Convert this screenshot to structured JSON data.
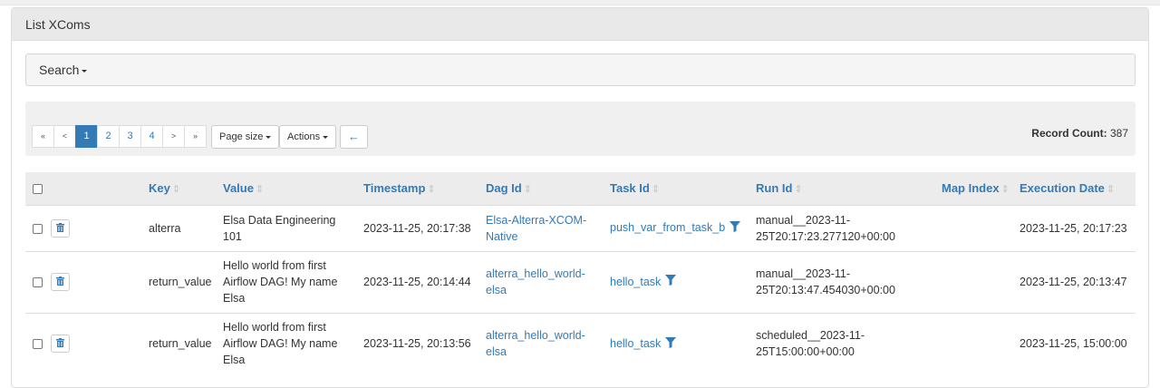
{
  "panel": {
    "title": "List XComs"
  },
  "search": {
    "label": "Search"
  },
  "pager": {
    "first": "«",
    "prev": "<",
    "pages": [
      "1",
      "2",
      "3",
      "4"
    ],
    "active_page": "1",
    "next": ">",
    "last": "»"
  },
  "toolbar": {
    "page_size_label": "Page size",
    "actions_label": "Actions",
    "back_icon": "←",
    "record_count_label": "Record Count:",
    "record_count_value": "387"
  },
  "table": {
    "columns": [
      "Key",
      "Value",
      "Timestamp",
      "Dag Id",
      "Task Id",
      "Run Id",
      "Map Index",
      "Execution Date"
    ],
    "rows": [
      {
        "key": "alterra",
        "value": [
          "Elsa Data Engineering",
          "101"
        ],
        "timestamp": "2023-11-25, 20:17:38",
        "dag_id": [
          "Elsa-Alterra-XCOM-",
          "Native"
        ],
        "task_id": "push_var_from_task_b",
        "run_id": [
          "manual__2023-11-",
          "25T20:17:23.277120+00:00"
        ],
        "map_index": "",
        "execution_date": "2023-11-25, 20:17:23"
      },
      {
        "key": "return_value",
        "value": [
          "Hello world from first",
          "Airflow DAG! My name",
          "Elsa"
        ],
        "timestamp": "2023-11-25, 20:14:44",
        "dag_id": [
          "alterra_hello_world-",
          "elsa"
        ],
        "task_id": "hello_task",
        "run_id": [
          "manual__2023-11-",
          "25T20:13:47.454030+00:00"
        ],
        "map_index": "",
        "execution_date": "2023-11-25, 20:13:47"
      },
      {
        "key": "return_value",
        "value": [
          "Hello world from first",
          "Airflow DAG! My name",
          "Elsa"
        ],
        "timestamp": "2023-11-25, 20:13:56",
        "dag_id": [
          "alterra_hello_world-",
          "elsa"
        ],
        "task_id": "hello_task",
        "run_id": [
          "scheduled__2023-11-",
          "25T15:00:00+00:00"
        ],
        "map_index": "",
        "execution_date": "2023-11-25, 15:00:00"
      }
    ]
  },
  "icons": {
    "sort": "sort-icon",
    "trash": "trash-icon",
    "filter": "filter-icon",
    "back": "arrow-left-icon"
  },
  "colors": {
    "link": "#337ab7",
    "active_page": "#337ab7",
    "header_bg": "#e9e9e9"
  }
}
